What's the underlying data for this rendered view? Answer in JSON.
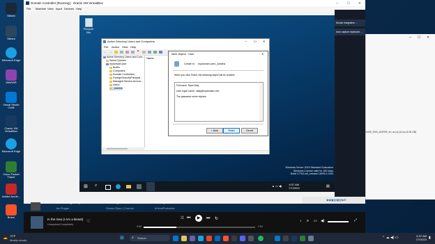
{
  "colors": {
    "accent": "#0078d4",
    "taskbar": "#1e2838",
    "guest_bg": "#0a4a7a"
  },
  "host_desktop": {
    "icons": [
      "Steam",
      "Micro...",
      "Microsoft Edge",
      "WinRAR",
      "Visual Studio Code",
      "Oracle VM VirtualBox",
      "Microsoft Edge",
      "Cisco Packet Tracer",
      "Adobe Acrob...",
      "Brave"
    ]
  },
  "vbox": {
    "title": "Domain Controller [Running] - Oracle VM VirtualBox",
    "menu": [
      "File",
      "Machine",
      "View",
      "Input",
      "Devices",
      "Help"
    ],
    "side_labels": [
      "Mouse integration ...",
      "Auto capture keyboard ..."
    ]
  },
  "guest": {
    "recycle_bin": "Recycle Bin",
    "watermark_line1": "Windows Server 2019 Standard Evaluation",
    "watermark_line2": "Windows License valid for 180 days",
    "watermark_line3": "Build 17763.rs5_release.180914-1434",
    "time": "6:37 AM",
    "date": "7/7/2023"
  },
  "aduc": {
    "title": "Active Directory Users and Computers",
    "menu": [
      "File",
      "Action",
      "View",
      "Help"
    ],
    "tree": [
      "Active Directory Users and Com...",
      "Saved Queries",
      "mydomain.com",
      "Builtin",
      "Computers",
      "Domain Controllers",
      "ForeignSecurityPrincipal...",
      "Managed Service Accour...",
      "Users",
      "_Admins"
    ],
    "list_header": "Name"
  },
  "dialog": {
    "title": "New Object - User",
    "create_in_label": "Create in:",
    "create_in_value": "mydomain.com/_Admins",
    "intro": "When you click Finish, the following object will be created:",
    "summary": [
      "Full name: Ryan Daly",
      "User logon name: rdaly@mydomain.com",
      "The password never expires."
    ],
    "back": "< Back",
    "finish": "Finish",
    "cancel": "Cancel"
  },
  "media": {
    "track1": "The Joe Rogan Expe...",
    "artist1": "Joe Rogan",
    "track2": "Shawn Ryan Show",
    "artist2": "Shawn Ryan | Comula",
    "track3": "Off Purpose w",
    "artist3": "#HeartPodcasts",
    "now_playing": "In the Sea (I Am a Beast)",
    "now_artist": "Unspoken/Completely",
    "elapsed": "0:50",
    "duration": "2:54"
  },
  "host_taskbar": {
    "weather_temp": "72°F",
    "weather_desc": "Mostly cloudy",
    "search": "Search",
    "time": "6:37 AM",
    "date": "7/7/2023"
  },
  "win2": {
    "path": "...d\\_2004\\50_ENS_x64FRE_en-us (1) (4).iso (5.36 GB)"
  }
}
